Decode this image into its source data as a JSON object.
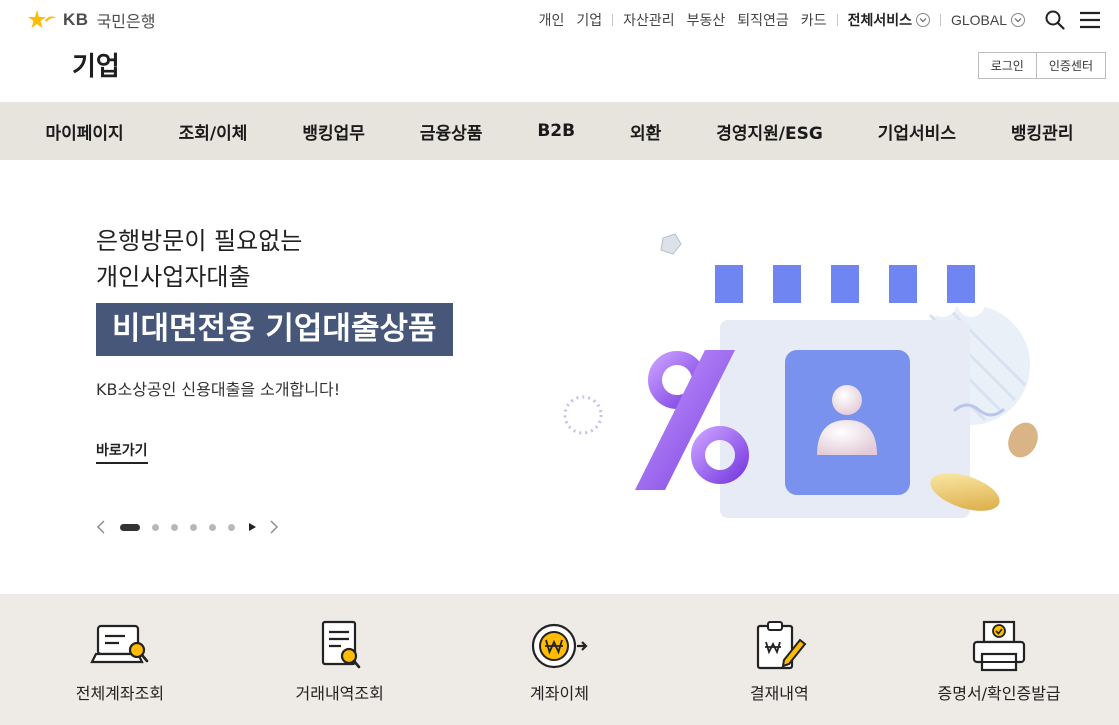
{
  "brand": {
    "logo_latin": "KB",
    "logo_korean": "국민은행"
  },
  "section_title": "기업",
  "util_nav": {
    "links": [
      "개인",
      "기업",
      "자산관리",
      "부동산",
      "퇴직연금",
      "카드"
    ],
    "all_services": "전체서비스",
    "global": "GLOBAL"
  },
  "auth": {
    "login": "로그인",
    "cert_center": "인증센터"
  },
  "gnb": [
    "마이페이지",
    "조회/이체",
    "뱅킹업무",
    "금융상품",
    "B2B",
    "외환",
    "경영지원/ESG",
    "기업서비스",
    "뱅킹관리"
  ],
  "hero": {
    "line1": "은행방문이 필요없는",
    "line2": "개인사업자대출",
    "headline": "비대면전용 기업대출상품",
    "description": "KB소상공인 신용대출을 소개합니다!",
    "cta": "바로가기",
    "slides_total": 6,
    "slide_active": 1
  },
  "quick_menu": [
    {
      "label": "전체계좌조회",
      "icon": "account-search-icon"
    },
    {
      "label": "거래내역조회",
      "icon": "transaction-search-icon"
    },
    {
      "label": "계좌이체",
      "icon": "won-transfer-icon"
    },
    {
      "label": "결재내역",
      "icon": "approval-document-icon"
    },
    {
      "label": "증명서/확인증발급",
      "icon": "certificate-printer-icon"
    }
  ],
  "colors": {
    "brand_yellow": "#ffbc00",
    "gnb_bg": "#e7e3dd",
    "headline_bg": "#465779",
    "quick_bg": "#eeebe7",
    "accent_purple": "#8b4fe0"
  }
}
